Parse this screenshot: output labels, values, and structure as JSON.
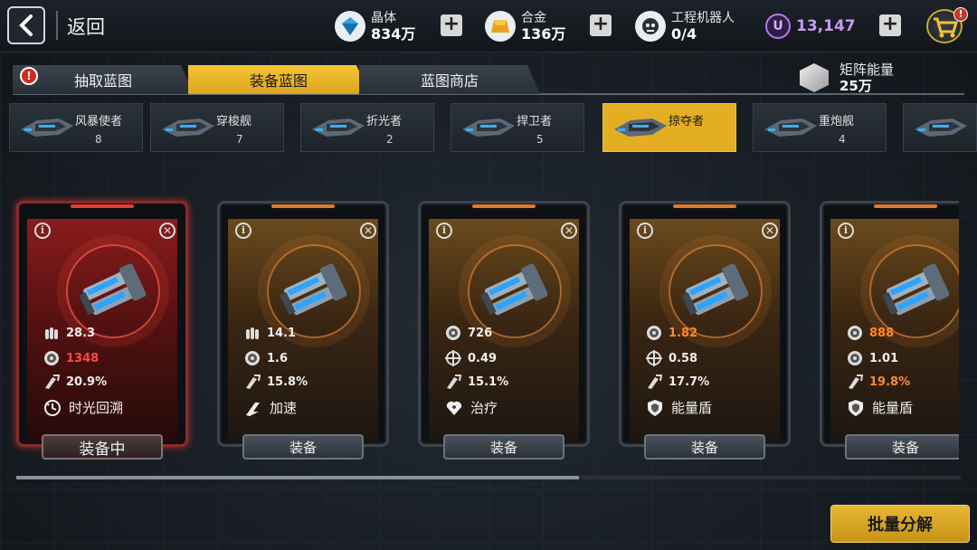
{
  "header": {
    "back_label": "返回"
  },
  "resources": {
    "crystal": {
      "name": "晶体",
      "value": "834万",
      "icon": "crystal-icon"
    },
    "alloy": {
      "name": "合金",
      "value": "136万",
      "icon": "alloy-icon"
    },
    "robot": {
      "name": "工程机器人",
      "value": "0/4",
      "icon": "robot-icon"
    },
    "u_currency": {
      "value": "13,147",
      "icon": "u-coin-icon"
    },
    "cart_badge": "!"
  },
  "tabs": [
    {
      "label": "抽取蓝图",
      "active": false
    },
    {
      "label": "装备蓝图",
      "active": true
    },
    {
      "label": "蓝图商店",
      "active": false
    }
  ],
  "matrix_energy": {
    "name": "矩阵能量",
    "value": "25万"
  },
  "ships": [
    {
      "name": "风暴使者",
      "count": "8"
    },
    {
      "name": "穿梭舰",
      "count": "7"
    },
    {
      "name": "折光者",
      "count": "2"
    },
    {
      "name": "捍卫者",
      "count": "5"
    },
    {
      "name": "掠夺者",
      "count": "",
      "active": true
    },
    {
      "name": "重炮舰",
      "count": "4"
    },
    {
      "name": "",
      "count": ""
    }
  ],
  "cards": [
    {
      "state": "equipped",
      "stats": [
        "28.3",
        "1348",
        "20.9%"
      ],
      "stat_icons": [
        "ammo-icon",
        "turbine-icon",
        "thruster-icon"
      ],
      "skill": "时光回溯",
      "skill_icon": "time-rewind-icon",
      "button": "装备中"
    },
    {
      "state": "normal",
      "stats": [
        "14.1",
        "1.6",
        "15.8%"
      ],
      "stat_icons": [
        "ammo-icon",
        "turbine-icon",
        "thruster-icon"
      ],
      "skill": "加速",
      "skill_icon": "boost-icon",
      "button": "装备"
    },
    {
      "state": "normal",
      "stats": [
        "726",
        "0.49",
        "15.1%"
      ],
      "stat_icons": [
        "turbine-icon",
        "crosshair-icon",
        "thruster-icon"
      ],
      "skill": "治疗",
      "skill_icon": "heal-icon",
      "button": "装备"
    },
    {
      "state": "normal",
      "stats": [
        "1.82",
        "0.58",
        "17.7%"
      ],
      "stat_icons": [
        "turbine-icon",
        "crosshair-icon",
        "thruster-icon"
      ],
      "skill": "能量盾",
      "skill_icon": "shield-icon",
      "button": "装备"
    },
    {
      "state": "normal",
      "stats": [
        "888",
        "1.01",
        "19.8%"
      ],
      "stat_icons": [
        "turbine-icon",
        "turbine-icon",
        "thruster-icon"
      ],
      "skill": "能量盾",
      "skill_icon": "shield-icon",
      "button": "装备"
    }
  ],
  "bulk_button": "批量分解",
  "colors": {
    "accent": "#E4AE23",
    "highlight": "#FF8A2A",
    "red_highlight": "#FF4A3A",
    "u_currency": "#C59AF0"
  }
}
